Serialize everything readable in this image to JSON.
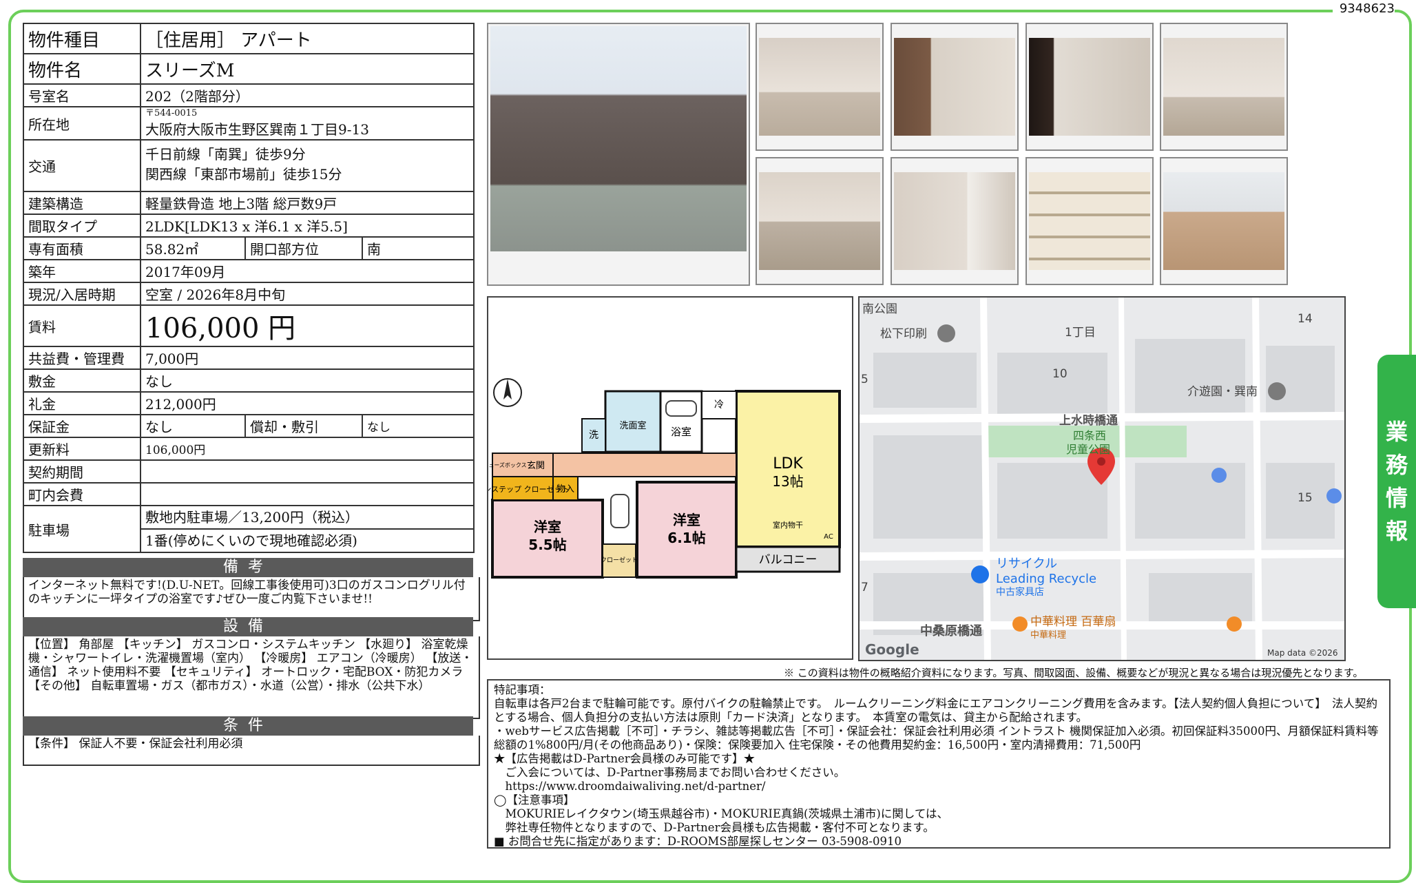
{
  "document_id": "9348623",
  "side_tab": [
    "業",
    "務",
    "情",
    "報"
  ],
  "info": {
    "type_label": "物件種目",
    "type_value": "［住居用］ アパート",
    "name_label": "物件名",
    "name_value": "スリーズM",
    "room_label": "号室名",
    "room_value": "202（2階部分）",
    "address_label": "所在地",
    "postal": "〒544-0015",
    "address_value": "大阪府大阪市生野区巽南１丁目9-13",
    "access_label": "交通",
    "access_line1": "千日前線「南巽」徒歩9分",
    "access_line2": "関西線「東部市場前」徒歩15分",
    "structure_label": "建築構造",
    "structure_value": "軽量鉄骨造 地上3階 総戸数9戸",
    "layout_label": "間取タイプ",
    "layout_value": "2LDK[LDK13 x 洋6.1 x 洋5.5]",
    "area_label": "専有面積",
    "area_value": "58.82㎡",
    "direction_label": "開口部方位",
    "direction_value": "南",
    "built_label": "築年",
    "built_value": "2017年09月",
    "status_label": "現況/入居時期",
    "status_value": "空室 / 2026年8月中旬",
    "rent_label": "賃料",
    "rent_value": "106,000 円",
    "mgmt_label": "共益費・管理費",
    "mgmt_value": "7,000円",
    "deposit_label": "敷金",
    "deposit_value": "なし",
    "keymoney_label": "礼金",
    "keymoney_value": "212,000円",
    "guarantee_label": "保証金",
    "guarantee_value": "なし",
    "amort_label": "償却・敷引",
    "amort_value": "なし",
    "renewal_label": "更新料",
    "renewal_value": "106,000円",
    "contract_label": "契約期間",
    "contract_value": "",
    "community_label": "町内会費",
    "community_value": "",
    "parking_label": "駐車場",
    "parking_line1": "敷地内駐車場／13,200円（税込）",
    "parking_line2": "1番(停めにくいので現地確認必須)"
  },
  "remarks": {
    "title": "備考",
    "text": "インターネット無料です!(D.U-NET。回線工事後使用可)3口のガスコンログリル付のキッチンに一坪タイプの浴室です♪ぜひ一度ご内覧下さいませ!!"
  },
  "facilities": {
    "title": "設備",
    "text": "【位置】 角部屋 【キッチン】 ガスコンロ・システムキッチン 【水廻り】 浴室乾燥機・シャワートイレ・洗濯機置場（室内） 【冷暖房】 エアコン（冷暖房） 【放送・通信】 ネット使用料不要 【セキュリティ】 オートロック・宅配BOX・防犯カメラ 【その他】 自転車置場・ガス（都市ガス）・水道（公営）・排水（公共下水）"
  },
  "conditions": {
    "title": "条件",
    "text": "【条件】 保証人不要・保証会社利用必須"
  },
  "floorplan": {
    "ldk": "LDK",
    "ldk_size": "13帖",
    "room1": "洋室",
    "room1_size": "5.5帖",
    "room2": "洋室",
    "room2_size": "6.1帖",
    "balcony": "バルコニー",
    "washroom": "洗面室",
    "bath": "浴室",
    "entrance": "玄関",
    "storage": "物入",
    "wash": "洗",
    "fridge": "冷",
    "closet_onestep": "ワンステップ クローゼット",
    "closet": "クローゼット",
    "shoes": "シューズボックス",
    "laundry": "室内物干",
    "ac": "AC"
  },
  "map": {
    "labels": [
      "南公園",
      "松下印刷",
      "1丁目",
      "14",
      "10",
      "5",
      "介遊園・巽南",
      "上水時橋通",
      "四条西",
      "児童公園",
      "15",
      "リサイクル",
      "Leading Recycle",
      "中古家具店",
      "7",
      "中桑原橋通",
      "中華料理 百華扇",
      "中華料理"
    ],
    "google": "Google",
    "copyright": "Map data ©2026"
  },
  "disclaimer": "※ この資料は物件の概略紹介資料になります。写真、間取図面、設備、概要などが現況と異なる場合は現況優先となります。",
  "special": {
    "lines": [
      "特記事項：",
      "自転車は各戸2台まで駐輪可能です。原付バイクの駐輪禁止です。　ルームクリーニング料金にエアコンクリーニング費用を含みます。【法人契約個人負担について】　法人契約とする場合、個人負担分の支払い方法は原則「カード決済」となります。　本賃室の電気は、貸主から配給されます。",
      "・webサービス広告掲載［不可］・チラシ、雑誌等掲載広告［不可］・保証会社：保証会社利用必須 イントラスト 機関保証加入必須。初回保証料35000円、月額保証料賃料等総額の1%800円/月(その他商品あり)・保険：保険要加入 住宅保険・その他費用契約金：16,500円・室内清掃費用：71,500円",
      "★【広告掲載はD-Partner会員様のみ可能です】★",
      "　ご入会については、D-Partner事務局までお問い合わせください。",
      "　https://www.droomdaiwaliving.net/d-partner/",
      "◯【注意事項】",
      "　MOKURIEレイクタウン(埼玉県越谷市)・MOKURIE真鍋(茨城県土浦市)に関しては、",
      "　弊社専任物件となりますので、D-Partner会員様も広告掲載・客付不可となります。",
      "■ お問合せ先に指定があります：D-ROOMS部屋探しセンター 03-5908-0910"
    ]
  }
}
